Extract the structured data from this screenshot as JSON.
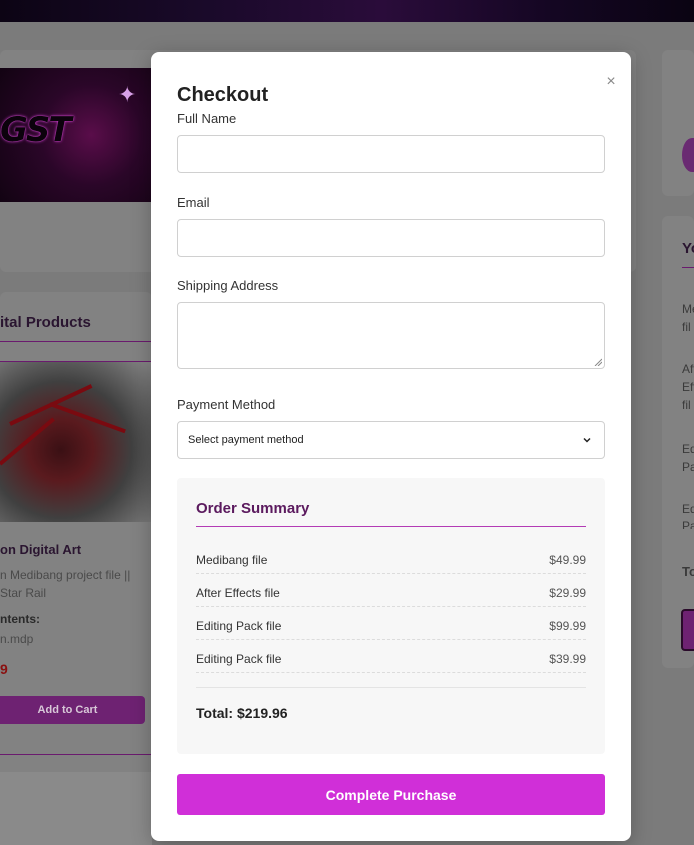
{
  "background": {
    "section_title": "ital Products",
    "product": {
      "name": "on Digital Art",
      "desc_line1": "n Medibang project file ||",
      "desc_line2": "Star Rail",
      "contents_label": "ntents:",
      "file": "n.mdp",
      "price": "9",
      "add_to_cart": "Add to Cart"
    },
    "right_panel": {
      "heading": "Yo",
      "items": [
        "Me",
        "fil",
        "Aft",
        "Eff",
        "fil",
        "Ed",
        "Pa",
        "Ed",
        "Pa"
      ],
      "total": "To"
    }
  },
  "modal": {
    "title": "Checkout",
    "close": "×",
    "fields": {
      "full_name_label": "Full Name",
      "full_name_value": "",
      "email_label": "Email",
      "email_value": "",
      "address_label": "Shipping Address",
      "address_value": "",
      "payment_label": "Payment Method",
      "payment_selected": "Select payment method"
    },
    "summary": {
      "title": "Order Summary",
      "items": [
        {
          "name": "Medibang file",
          "price": "$49.99"
        },
        {
          "name": "After Effects file",
          "price": "$29.99"
        },
        {
          "name": "Editing Pack file",
          "price": "$99.99"
        },
        {
          "name": "Editing Pack file",
          "price": "$39.99"
        }
      ],
      "total": "Total: $219.96"
    },
    "purchase_button": "Complete Purchase"
  },
  "colors": {
    "accent": "#d02fd8",
    "summary_title": "#5b1a5e",
    "summary_rule": "#b33bb5"
  }
}
